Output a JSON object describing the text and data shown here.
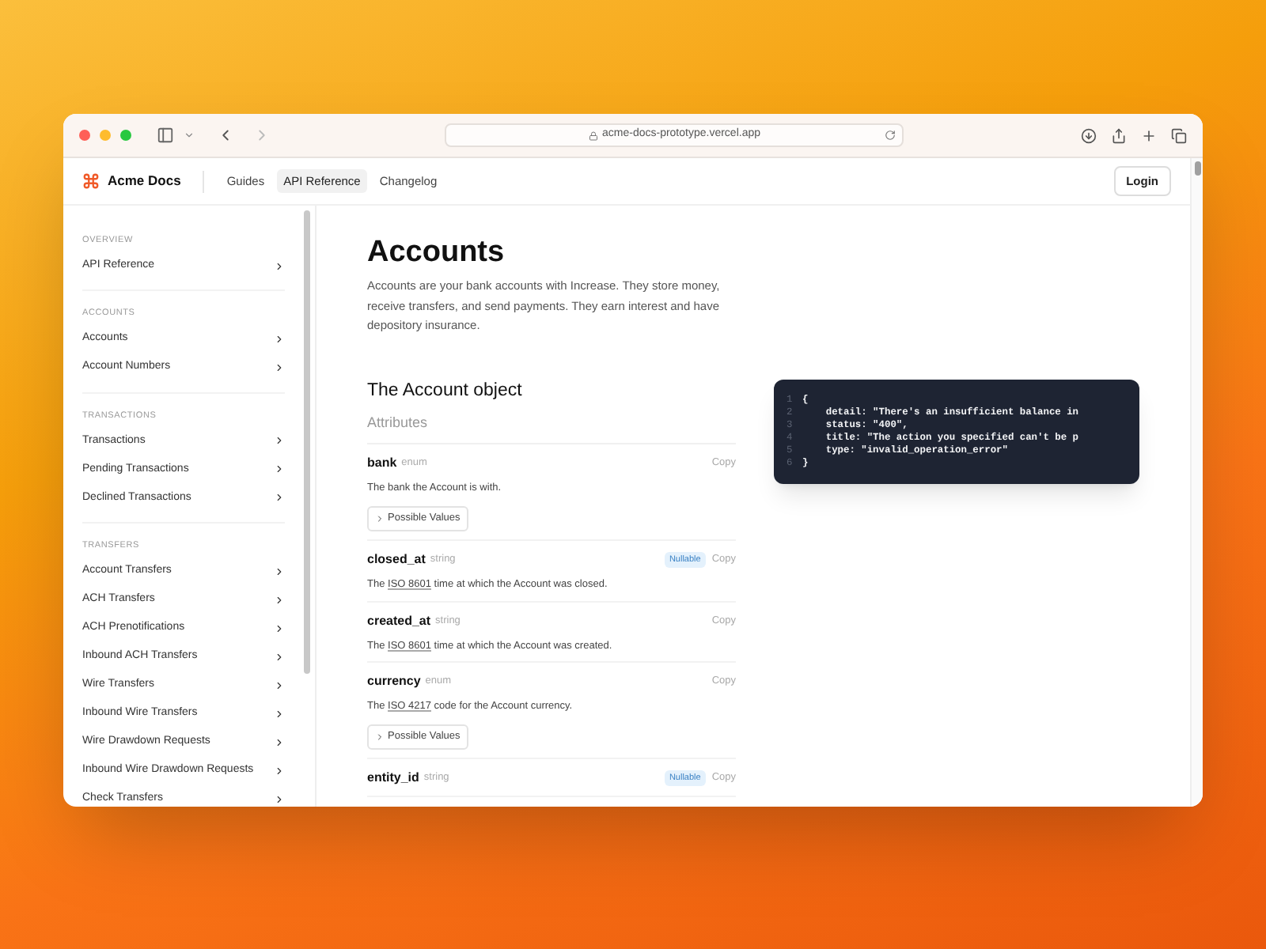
{
  "browser": {
    "url": "acme-docs-prototype.vercel.app"
  },
  "header": {
    "logo": "Acme Docs",
    "nav": [
      {
        "label": "Guides",
        "selected": false
      },
      {
        "label": "API Reference",
        "selected": true
      },
      {
        "label": "Changelog",
        "selected": false
      }
    ],
    "login": "Login"
  },
  "sidebar": {
    "sections": [
      {
        "title": "OVERVIEW",
        "items": [
          "API Reference"
        ]
      },
      {
        "title": "ACCOUNTS",
        "items": [
          "Accounts",
          "Account Numbers"
        ]
      },
      {
        "title": "TRANSACTIONS",
        "items": [
          "Transactions",
          "Pending Transactions",
          "Declined Transactions"
        ]
      },
      {
        "title": "TRANSFERS",
        "items": [
          "Account Transfers",
          "ACH Transfers",
          "ACH Prenotifications",
          "Inbound ACH Transfers",
          "Wire Transfers",
          "Inbound Wire Transfers",
          "Wire Drawdown Requests",
          "Inbound Wire Drawdown Requests",
          "Check Transfers"
        ]
      }
    ]
  },
  "page": {
    "title": "Accounts",
    "intro": "Accounts are your bank accounts with Increase. They store money, receive transfers, and send payments. They earn interest and have depository insurance.",
    "object_title": "The Account object",
    "attributes_label": "Attributes",
    "attributes": [
      {
        "name": "bank",
        "type": "enum",
        "copy": "Copy",
        "description": {
          "before": "The bank the Account is with."
        },
        "possible_values": "Possible Values"
      },
      {
        "name": "closed_at",
        "type": "string",
        "badge": "Nullable",
        "copy": "Copy",
        "description": {
          "before": "The",
          "link": "ISO 8601",
          "after": "time at which the Account was closed."
        }
      },
      {
        "name": "created_at",
        "type": "string",
        "copy": "Copy",
        "description": {
          "before": "The",
          "link": "ISO 8601",
          "after": "time at which the Account was created."
        }
      },
      {
        "name": "currency",
        "type": "enum",
        "copy": "Copy",
        "description": {
          "before": "The",
          "link": "ISO 4217",
          "after": "code for the Account currency."
        },
        "possible_values": "Possible Values"
      },
      {
        "name": "entity_id",
        "type": "string",
        "badge": "Nullable",
        "copy": "Copy"
      }
    ]
  },
  "code": {
    "lines": [
      {
        "number": "1",
        "text": "{"
      },
      {
        "number": "2",
        "text": "    detail: \"There's an insufficient balance in"
      },
      {
        "number": "3",
        "text": "    status: \"400\","
      },
      {
        "number": "4",
        "text": "    title: \"The action you specified can't be p"
      },
      {
        "number": "5",
        "text": "    type: \"invalid_operation_error\""
      },
      {
        "number": "6",
        "text": "}"
      }
    ]
  }
}
